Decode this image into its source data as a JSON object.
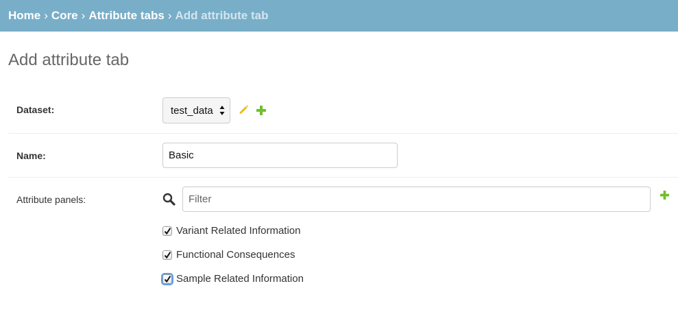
{
  "breadcrumbs": {
    "home": "Home",
    "core": "Core",
    "attribute_tabs": "Attribute tabs",
    "current": "Add attribute tab",
    "separator": "›"
  },
  "page_title": "Add attribute tab",
  "form": {
    "dataset": {
      "label": "Dataset:",
      "selected": "test_data",
      "edit_icon": "pencil-icon",
      "add_icon": "plus-icon"
    },
    "name": {
      "label": "Name:",
      "value": "Basic"
    },
    "attribute_panels": {
      "label": "Attribute panels:",
      "filter_placeholder": "Filter",
      "options": [
        {
          "label": "Variant Related Information",
          "checked": true
        },
        {
          "label": "Functional Consequences",
          "checked": true
        },
        {
          "label": "Sample Related Information",
          "checked": true
        }
      ]
    }
  },
  "colors": {
    "header_bg": "#79aec8",
    "breadcrumb_current": "#d2e6ef",
    "add_green": "#70bf2b",
    "edit_yellow": "#efb80b",
    "focus_ring": "#5b9ee8"
  }
}
